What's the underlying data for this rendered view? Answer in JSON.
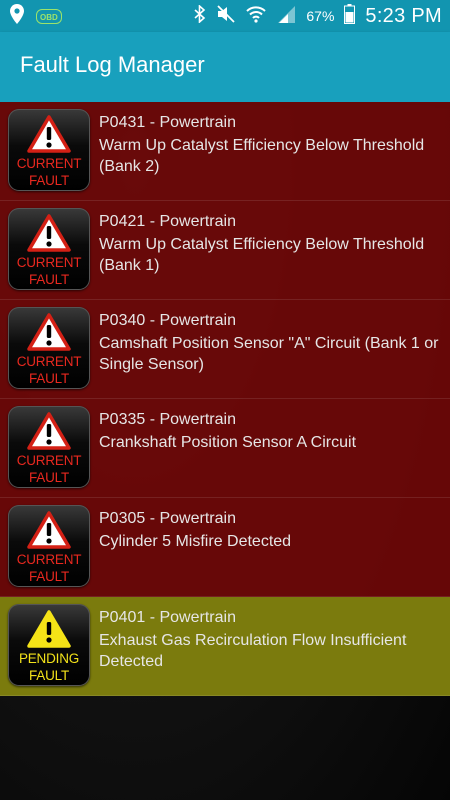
{
  "status_bar": {
    "notifications": [
      "location-icon",
      "obd-icon"
    ],
    "obd_label": "OBD",
    "battery_percent": "67%",
    "time": "5:23 PM"
  },
  "app_bar": {
    "title": "Fault Log Manager"
  },
  "colors": {
    "status_bar": "#1295b0",
    "app_bar": "#18a0bd",
    "current_row": "#6e0808",
    "pending_row": "#80800e",
    "current_badge_text": "#e8281f",
    "pending_badge_text": "#f2e21a"
  },
  "faults": [
    {
      "status": "current",
      "badge_line1": "CURRENT",
      "badge_line2": "FAULT",
      "code": "P0431 - Powertrain",
      "description": "Warm Up Catalyst Efficiency Below Threshold (Bank 2)"
    },
    {
      "status": "current",
      "badge_line1": "CURRENT",
      "badge_line2": "FAULT",
      "code": "P0421 - Powertrain",
      "description": "Warm Up Catalyst Efficiency Below Threshold (Bank 1)"
    },
    {
      "status": "current",
      "badge_line1": "CURRENT",
      "badge_line2": "FAULT",
      "code": "P0340 - Powertrain",
      "description": "Camshaft Position Sensor \"A\" Circuit (Bank 1 or Single Sensor)"
    },
    {
      "status": "current",
      "badge_line1": "CURRENT",
      "badge_line2": "FAULT",
      "code": "P0335 - Powertrain",
      "description": "Crankshaft Position Sensor A Circuit"
    },
    {
      "status": "current",
      "badge_line1": "CURRENT",
      "badge_line2": "FAULT",
      "code": "P0305 - Powertrain",
      "description": "Cylinder 5 Misfire Detected"
    },
    {
      "status": "pending",
      "badge_line1": "PENDING",
      "badge_line2": "FAULT",
      "code": "P0401 - Powertrain",
      "description": "Exhaust Gas Recirculation Flow Insufficient Detected"
    }
  ]
}
